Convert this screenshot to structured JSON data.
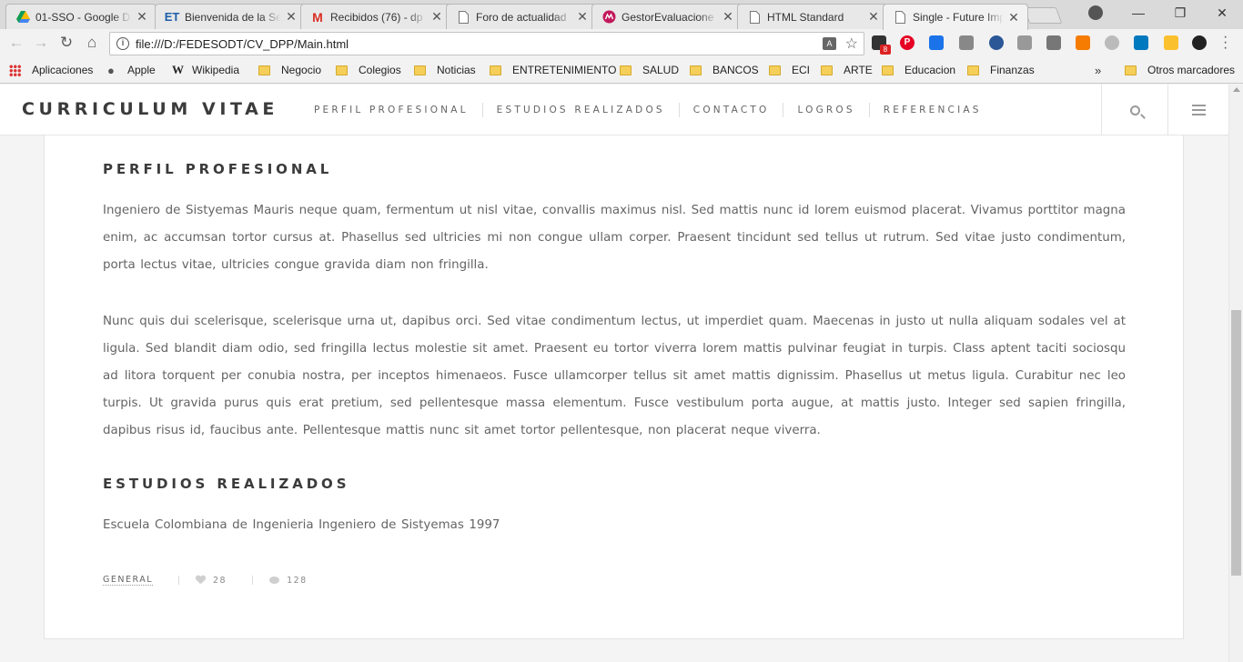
{
  "browser": {
    "tabs": [
      {
        "title": "01-SSO - Google D",
        "icon": "google-drive-icon",
        "color": "#1fa463"
      },
      {
        "title": "Bienvenida de la Se",
        "icon": "et-icon",
        "color": "#1d5fa8"
      },
      {
        "title": "Recibidos (76) - dp",
        "icon": "gmail-icon",
        "color": "#d93025"
      },
      {
        "title": "Foro de actualidad",
        "icon": "page-icon",
        "color": "#777777"
      },
      {
        "title": "GestorEvaluacione",
        "icon": "app-icon",
        "color": "#c2185b"
      },
      {
        "title": "HTML Standard",
        "icon": "page-icon",
        "color": "#777777"
      },
      {
        "title": "Single - Future Imp",
        "icon": "page-icon",
        "color": "#777777"
      }
    ],
    "address": "file:///D:/FEDESODT/CV_DPP/Main.html",
    "extension_badge": "8",
    "bookmarks": [
      {
        "label": "Aplicaciones",
        "icon": "apps-icon"
      },
      {
        "label": "Apple",
        "icon": "apple-icon"
      },
      {
        "label": "Wikipedia",
        "icon": "wikipedia-icon"
      },
      {
        "label": "Negocio",
        "icon": "folder-icon"
      },
      {
        "label": "Colegios",
        "icon": "folder-icon"
      },
      {
        "label": "Noticias",
        "icon": "folder-icon"
      },
      {
        "label": "ENTRETENIMIENTO",
        "icon": "folder-icon"
      },
      {
        "label": "SALUD",
        "icon": "folder-icon"
      },
      {
        "label": "BANCOS",
        "icon": "folder-icon"
      },
      {
        "label": "ECI",
        "icon": "folder-icon"
      },
      {
        "label": "ARTE",
        "icon": "folder-icon"
      },
      {
        "label": "Educacion",
        "icon": "folder-icon"
      },
      {
        "label": "Finanzas",
        "icon": "folder-icon"
      }
    ],
    "bookmarks_overflow": "»",
    "other_bookmarks": "Otros marcadores"
  },
  "site": {
    "title": "CURRICULUM VITAE",
    "nav": [
      "PERFIL PROFESIONAL",
      "ESTUDIOS REALIZADOS",
      "CONTACTO",
      "LOGROS",
      "REFERENCIAS"
    ]
  },
  "article": {
    "section1_title": "PERFIL PROFESIONAL",
    "paragraph1": "Ingeniero de Sistyemas Mauris neque quam, fermentum ut nisl vitae, convallis maximus nisl. Sed mattis nunc id lorem euismod placerat. Vivamus porttitor magna enim, ac accumsan tortor cursus at. Phasellus sed ultricies mi non congue ullam corper. Praesent tincidunt sed tellus ut rutrum. Sed vitae justo condimentum, porta lectus vitae, ultricies congue gravida diam non fringilla.",
    "paragraph2": "Nunc quis dui scelerisque, scelerisque urna ut, dapibus orci. Sed vitae condimentum lectus, ut imperdiet quam. Maecenas in justo ut nulla aliquam sodales vel at ligula. Sed blandit diam odio, sed fringilla lectus molestie sit amet. Praesent eu tortor viverra lorem mattis pulvinar feugiat in turpis. Class aptent taciti sociosqu ad litora torquent per conubia nostra, per inceptos himenaeos. Fusce ullamcorper tellus sit amet mattis dignissim. Phasellus ut metus ligula. Curabitur nec leo turpis. Ut gravida purus quis erat pretium, sed pellentesque massa elementum. Fusce vestibulum porta augue, at mattis justo. Integer sed sapien fringilla, dapibus risus id, faucibus ante. Pellentesque mattis nunc sit amet tortor pellentesque, non placerat neque viverra.",
    "section2_title": "ESTUDIOS REALIZADOS",
    "paragraph3": "Escuela Colombiana de Ingenieria Ingeniero de Sistyemas 1997",
    "category": "GENERAL",
    "likes": "28",
    "comments": "128"
  }
}
